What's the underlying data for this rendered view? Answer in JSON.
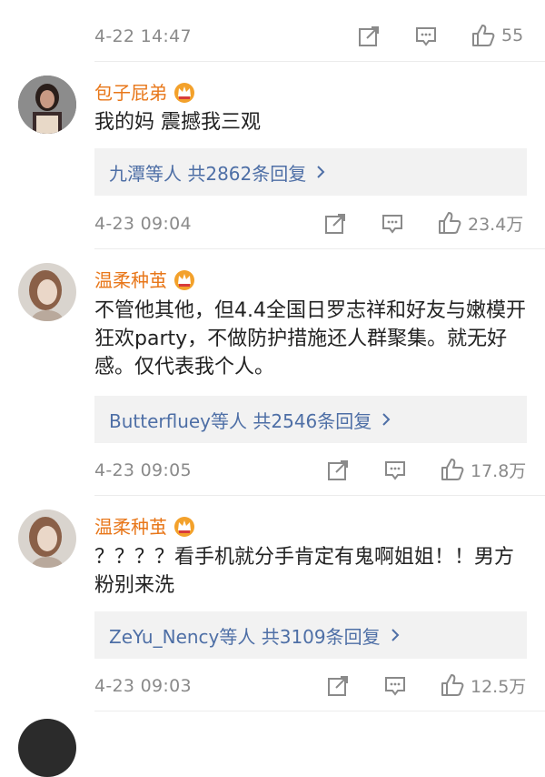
{
  "top_row": {
    "time": "4-22 14:47",
    "likes": "55"
  },
  "comments": [
    {
      "username": "包子屁弟",
      "text": "我的妈 震撼我三观",
      "reply_summary": "九潭等人  共2862条回复",
      "time": "4-23 09:04",
      "likes": "23.4万"
    },
    {
      "username": "温柔种茧",
      "text": "不管他其他，但4.4全国日罗志祥和好友与嫩模开狂欢party，不做防护措施还人群聚集。就无好感。仅代表我个人。",
      "reply_summary": "Butterfluey等人  共2546条回复",
      "time": "4-23 09:05",
      "likes": "17.8万"
    },
    {
      "username": "温柔种茧",
      "text": "？？？？看手机就分手肯定有鬼啊姐姐！！男方粉别来洗",
      "reply_summary": "ZeYu_Nency等人  共3109条回复",
      "time": "4-23 09:03",
      "likes": "12.5万"
    }
  ],
  "icons": {
    "share": "share-icon",
    "comment": "comment-icon",
    "like": "like-icon",
    "vip": "vip-crown-icon"
  },
  "colors": {
    "username": "#e8771a",
    "reply_link": "#4e6fa6",
    "meta": "#8a8a8a",
    "reply_bg": "#f2f2f2"
  }
}
